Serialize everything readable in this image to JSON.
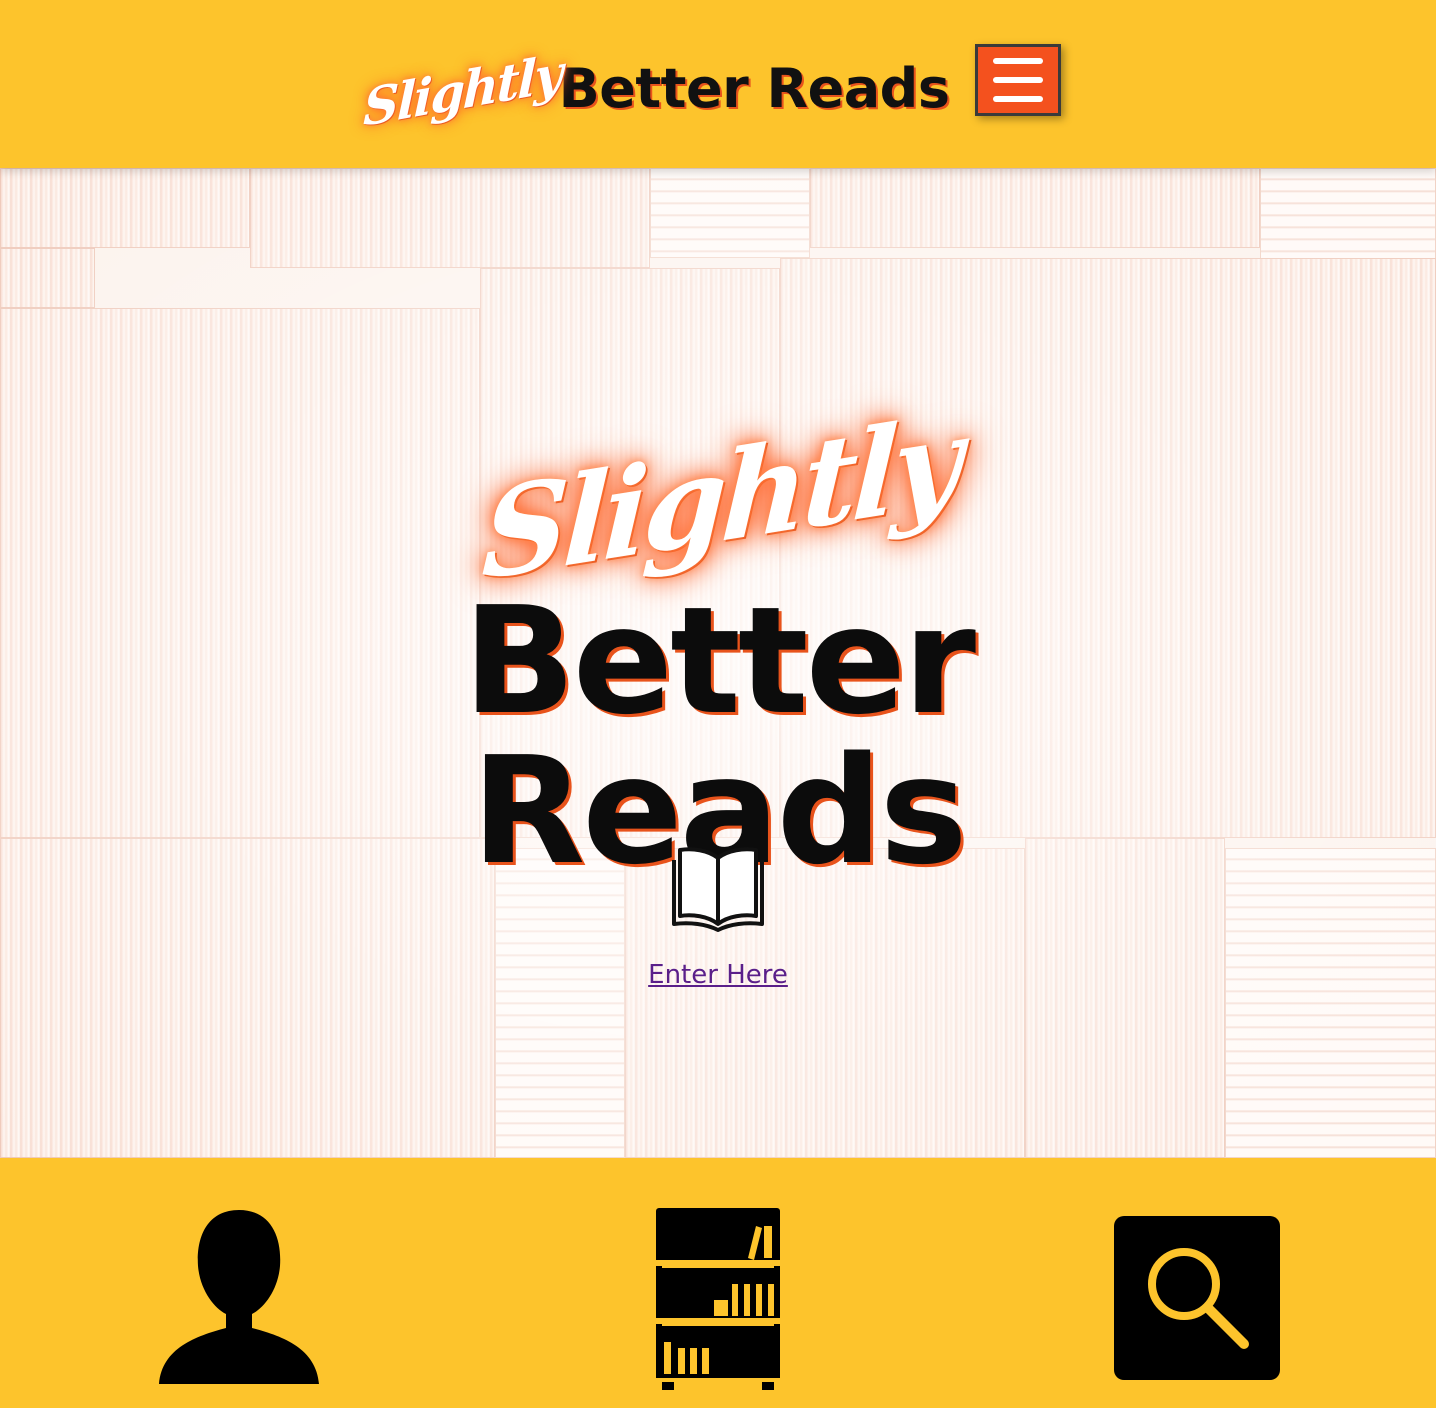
{
  "header": {
    "logo_script": "Slightly",
    "logo_title": "Better Reads"
  },
  "hero": {
    "script": "Slightly",
    "title_line1": "Better",
    "title_line2": "Reads",
    "enter_link": "Enter Here"
  },
  "bottom_nav": {
    "items": [
      {
        "icon": "user-icon"
      },
      {
        "icon": "bookshelf-icon"
      },
      {
        "icon": "search-icon"
      }
    ]
  },
  "colors": {
    "brand_yellow": "#fdc42c",
    "accent_orange": "#f4511e",
    "text_dark": "#0c0c0c",
    "link_purple": "#5a1f8a"
  }
}
